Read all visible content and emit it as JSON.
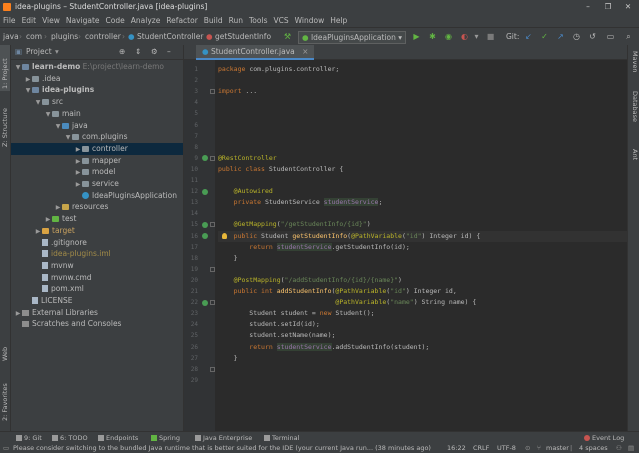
{
  "window": {
    "title": "idea-plugins – StudentController.java [idea-plugins]",
    "controls": [
      "–",
      "❐",
      "✕"
    ]
  },
  "menu": [
    "File",
    "Edit",
    "View",
    "Navigate",
    "Code",
    "Analyze",
    "Refactor",
    "Build",
    "Run",
    "Tools",
    "VCS",
    "Window",
    "Help"
  ],
  "breadcrumbs": [
    "java",
    "com",
    "plugins",
    "controller",
    "StudentController",
    "getStudentInfo"
  ],
  "toolbar": {
    "run_config": "IdeaPluginsApplication",
    "git_label": "Git:"
  },
  "project_panel": {
    "title": "Project",
    "tree": [
      {
        "depth": 0,
        "arrow": "▼",
        "icon": "mod",
        "label": "learn-demo",
        "bold": true,
        "path": "E:\\project\\learn-demo"
      },
      {
        "depth": 1,
        "arrow": "▶",
        "icon": "folder",
        "label": ".idea"
      },
      {
        "depth": 1,
        "arrow": "▼",
        "icon": "mod",
        "label": "idea-plugins",
        "bold": true
      },
      {
        "depth": 2,
        "arrow": "▼",
        "icon": "folder",
        "label": "src"
      },
      {
        "depth": 3,
        "arrow": "▼",
        "icon": "folder",
        "label": "main"
      },
      {
        "depth": 4,
        "arrow": "▼",
        "icon": "src",
        "label": "java"
      },
      {
        "depth": 5,
        "arrow": "▼",
        "icon": "pkg",
        "label": "com.plugins"
      },
      {
        "depth": 6,
        "arrow": "▶",
        "icon": "pkg",
        "label": "controller",
        "selected": true
      },
      {
        "depth": 6,
        "arrow": "▶",
        "icon": "pkg",
        "label": "mapper"
      },
      {
        "depth": 6,
        "arrow": "▶",
        "icon": "pkg",
        "label": "model"
      },
      {
        "depth": 6,
        "arrow": "▶",
        "icon": "pkg",
        "label": "service"
      },
      {
        "depth": 6,
        "arrow": "",
        "icon": "cls",
        "label": "IdeaPluginsApplication"
      },
      {
        "depth": 4,
        "arrow": "▶",
        "icon": "res",
        "label": "resources"
      },
      {
        "depth": 3,
        "arrow": "▶",
        "icon": "test",
        "label": "test"
      },
      {
        "depth": 2,
        "arrow": "▶",
        "icon": "excl",
        "label": "target",
        "style": "orange"
      },
      {
        "depth": 2,
        "arrow": "",
        "icon": "file",
        "label": ".gitignore"
      },
      {
        "depth": 2,
        "arrow": "",
        "icon": "file",
        "label": "idea-plugins.iml",
        "style": "iml"
      },
      {
        "depth": 2,
        "arrow": "",
        "icon": "file",
        "label": "mvnw"
      },
      {
        "depth": 2,
        "arrow": "",
        "icon": "file",
        "label": "mvnw.cmd"
      },
      {
        "depth": 2,
        "arrow": "",
        "icon": "file",
        "label": "pom.xml"
      },
      {
        "depth": 1,
        "arrow": "",
        "icon": "file",
        "label": "LICENSE"
      },
      {
        "depth": 0,
        "arrow": "▶",
        "icon": "lib",
        "label": "External Libraries"
      },
      {
        "depth": 0,
        "arrow": "",
        "icon": "lib",
        "label": "Scratches and Consoles"
      }
    ]
  },
  "left_tabs": [
    "1: Project",
    "Z: Structure",
    "Web",
    "2: Favorites"
  ],
  "right_tabs": [
    "Maven",
    "Database",
    "Ant"
  ],
  "editor": {
    "tab": "StudentController.java",
    "current_line": 16,
    "lines": [
      [
        [
          "kw",
          "package "
        ],
        [
          "",
          "com.plugins.controller;"
        ]
      ],
      [],
      [
        [
          "kw",
          "import "
        ],
        [
          "",
          "..."
        ]
      ],
      [],
      [
        [
          "ann",
          "@RestController"
        ]
      ],
      [
        [
          "kw",
          "public class "
        ],
        [
          "",
          "StudentController {"
        ]
      ],
      [],
      [
        [
          "ann",
          "    @Autowired"
        ]
      ],
      [
        [
          "kw",
          "    private "
        ],
        [
          "",
          "StudentService "
        ],
        [
          "fldhl",
          "studentService"
        ],
        [
          "",
          ";"
        ]
      ],
      [],
      [
        [
          "ann",
          "    @GetMapping"
        ],
        [
          "",
          "("
        ],
        [
          "str",
          "\"/getStudentInfo/{id}\""
        ],
        [
          "",
          ")"
        ]
      ],
      [
        [
          "kw",
          "    public "
        ],
        [
          "",
          "Student "
        ],
        [
          "fn",
          "getStudentInfo"
        ],
        [
          "",
          "("
        ],
        [
          "ann",
          "@PathVariable"
        ],
        [
          "",
          "("
        ],
        [
          "str",
          "\"id\""
        ],
        [
          "",
          ") Integer id) {"
        ]
      ],
      [
        [
          "kw",
          "        return "
        ],
        [
          "fldhl",
          "studentService"
        ],
        [
          "",
          ".getStudentInfo(id);"
        ]
      ],
      [
        [
          "",
          "    }"
        ]
      ],
      [],
      [
        [
          "ann",
          "    @PostMapping"
        ],
        [
          "",
          "("
        ],
        [
          "str",
          "\"/addStudentInfo/{id}/{name}\""
        ],
        [
          "",
          ")"
        ]
      ],
      [
        [
          "kw",
          "    public int "
        ],
        [
          "fn",
          "addStudentInfo"
        ],
        [
          "",
          "("
        ],
        [
          "ann",
          "@PathVariable"
        ],
        [
          "",
          "("
        ],
        [
          "str",
          "\"id\""
        ],
        [
          "",
          ") Integer id,"
        ]
      ],
      [
        [
          "",
          "                              "
        ],
        [
          "ann",
          "@PathVariable"
        ],
        [
          "",
          "("
        ],
        [
          "str",
          "\"name\""
        ],
        [
          "",
          ") String name) {"
        ]
      ],
      [
        [
          "",
          "        Student student = "
        ],
        [
          "kw",
          "new "
        ],
        [
          "",
          "Student();"
        ]
      ],
      [
        [
          "",
          "        student.setId(id);"
        ]
      ],
      [
        [
          "",
          "        student.setName(name);"
        ]
      ],
      [
        [
          "kw",
          "        return "
        ],
        [
          "fldhl",
          "studentService"
        ],
        [
          "",
          ".addStudentInfo(student);"
        ]
      ],
      [
        [
          "",
          "    }"
        ]
      ],
      [],
      [],
      [
        [
          "",
          "}"
        ]
      ],
      [],
      []
    ],
    "line_numbers": [
      "7",
      "8",
      "9",
      "10",
      "11",
      "12",
      "13",
      "14",
      "15",
      "16",
      "17",
      "18",
      "19",
      "20",
      "21",
      "22",
      "23",
      "24",
      "25",
      "26",
      "27",
      "28",
      "29"
    ]
  },
  "bottom_tools": [
    "9: Git",
    "6: TODO",
    "Endpoints",
    "Spring",
    "Java Enterprise",
    "Terminal"
  ],
  "event_log": "Event Log",
  "status": {
    "message": "Please consider switching to the bundled Java runtime that is better suited for the IDE (your current Java run... (38 minutes ago)",
    "position": "16:22",
    "line_sep": "CRLF",
    "encoding": "UTF-8",
    "indent": "4 spaces",
    "branch": "master"
  }
}
